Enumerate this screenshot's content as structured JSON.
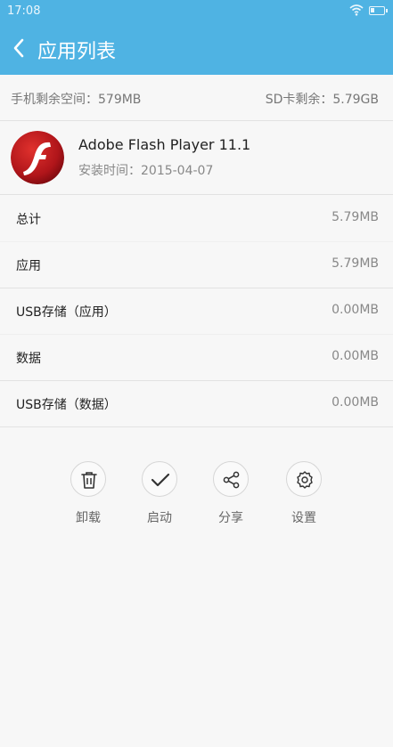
{
  "status_bar": {
    "time": "17:08",
    "icons": [
      "wifi-icon",
      "battery-icon"
    ]
  },
  "header": {
    "back_icon": "chevron-left-icon",
    "title": "应用列表",
    "color": "#4fb3e3"
  },
  "storage": {
    "phone": "手机剩余空间：579MB",
    "sd": "SD卡剩余：5.79GB"
  },
  "app": {
    "icon": "flash-player-icon",
    "name": "Adobe Flash Player 11.1",
    "install_date": "安装时间：2015-04-07"
  },
  "sizes": [
    {
      "label": "总计",
      "value": "5.79MB"
    },
    {
      "label": "应用",
      "value": "5.79MB"
    },
    {
      "label": "USB存储（应用）",
      "value": "0.00MB"
    },
    {
      "label": "数据",
      "value": "0.00MB"
    },
    {
      "label": "USB存储（数据）",
      "value": "0.00MB"
    }
  ],
  "actions": [
    {
      "label": "卸载",
      "icon": "trash-icon"
    },
    {
      "label": "启动",
      "icon": "check-icon"
    },
    {
      "label": "分享",
      "icon": "share-icon"
    },
    {
      "label": "设置",
      "icon": "gear-icon"
    }
  ]
}
